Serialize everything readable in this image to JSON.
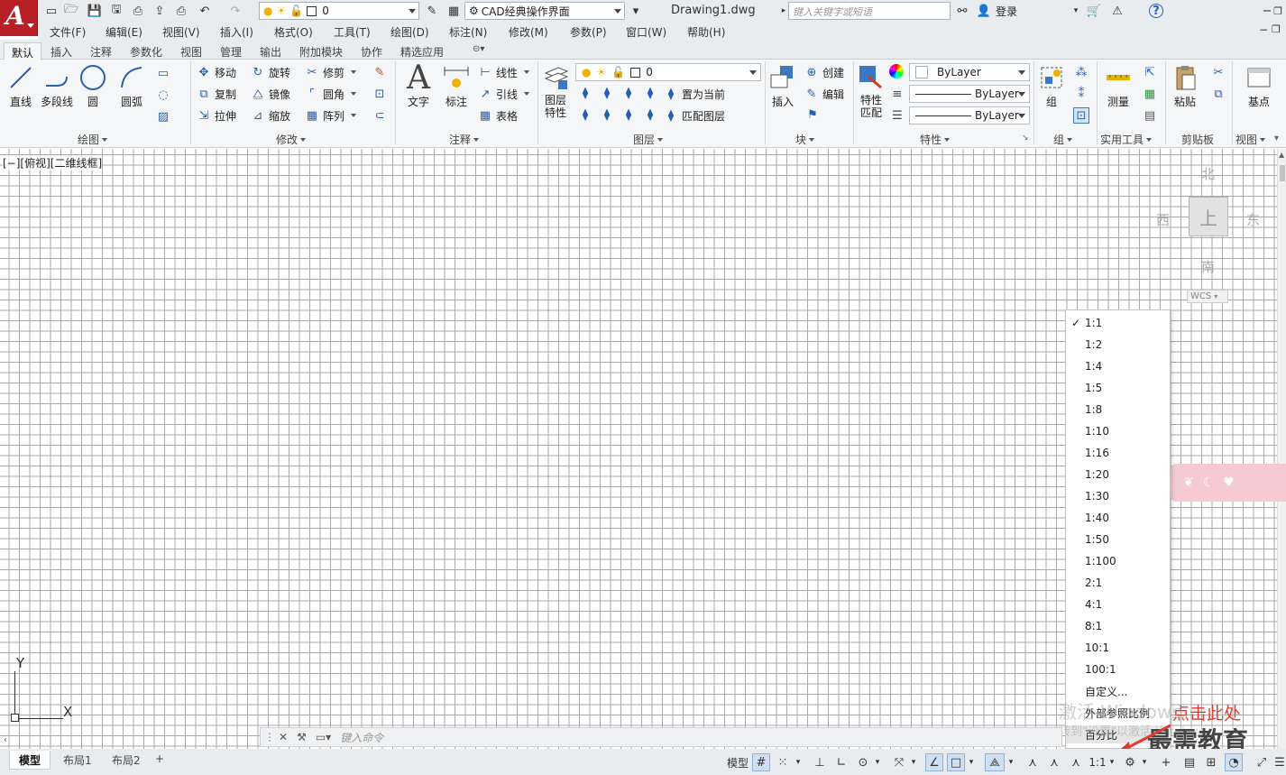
{
  "app": {
    "doc_title": "Drawing1.dwg",
    "search_placeholder": "键入关键字或短语",
    "login": "登录",
    "workspace": "CAD经典操作界面",
    "layer_current": "0"
  },
  "menu": [
    "文件(F)",
    "编辑(E)",
    "视图(V)",
    "插入(I)",
    "格式(O)",
    "工具(T)",
    "绘图(D)",
    "标注(N)",
    "修改(M)",
    "参数(P)",
    "窗口(W)",
    "帮助(H)"
  ],
  "ribbon_tabs": [
    "默认",
    "插入",
    "注释",
    "参数化",
    "视图",
    "管理",
    "输出",
    "附加模块",
    "协作",
    "精选应用"
  ],
  "ribbon": {
    "draw": {
      "title": "绘图",
      "line": "直线",
      "polyline": "多段线",
      "circle": "圆",
      "arc": "圆弧"
    },
    "modify": {
      "title": "修改",
      "move": "移动",
      "rotate": "旋转",
      "trim": "修剪",
      "copy": "复制",
      "mirror": "镜像",
      "fillet": "圆角",
      "stretch": "拉伸",
      "scale": "缩放",
      "array": "阵列"
    },
    "annotation": {
      "title": "注释",
      "text": "文字",
      "dimension": "标注",
      "linear": "线性",
      "leader": "引线",
      "table": "表格"
    },
    "layers": {
      "title": "图层",
      "props_line1": "图层",
      "props_line2": "特性",
      "layer_value": "0",
      "set_current": "置为当前",
      "match_layer": "匹配图层"
    },
    "block": {
      "title": "块",
      "insert": "插入",
      "create": "创建",
      "edit": "编辑"
    },
    "properties": {
      "title": "特性",
      "match_line1": "特性",
      "match_line2": "匹配",
      "color": "ByLayer",
      "linetype": "ByLayer",
      "lineweight": "ByLayer"
    },
    "groups": {
      "title": "组",
      "group": "组"
    },
    "utilities": {
      "title": "实用工具",
      "measure": "测量"
    },
    "clipboard": {
      "title": "剪贴板",
      "paste": "粘贴"
    },
    "view": {
      "title": "视图",
      "base": "基点"
    }
  },
  "viewport_label": "[−][俯视][二维线框]",
  "viewcube": {
    "north": "北",
    "south": "南",
    "east": "东",
    "west": "西",
    "top": "上",
    "wcs": "WCS"
  },
  "ucs": {
    "x": "X",
    "y": "Y"
  },
  "scale_menu": {
    "selected": "1:1",
    "options": [
      "1:1",
      "1:2",
      "1:4",
      "1:5",
      "1:8",
      "1:10",
      "1:16",
      "1:20",
      "1:30",
      "1:40",
      "1:50",
      "1:100",
      "2:1",
      "4:1",
      "8:1",
      "10:1",
      "100:1",
      "自定义...",
      "外部参照比例",
      "百分比"
    ]
  },
  "command_line": {
    "placeholder": "键入命令"
  },
  "layout_tabs": [
    "模型",
    "布局1",
    "布局2"
  ],
  "status": {
    "model": "模型",
    "scale": "1:1"
  },
  "overlay": {
    "activate_line1": "激活 Windows",
    "activate_line2": "转到\"设置\"以激活 Windows。",
    "annotation": "点击此处",
    "brand": "最需教育"
  },
  "colors": {
    "accent_red": "#b82025",
    "annotation_red": "#e03c31",
    "ribbon_bg": "#f5f6f7"
  }
}
